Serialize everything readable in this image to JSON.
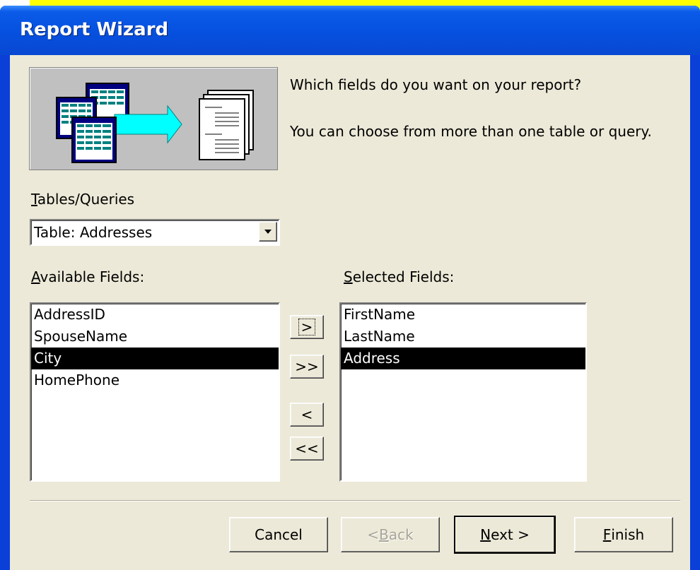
{
  "window": {
    "title": "Report Wizard"
  },
  "prompt": {
    "line1": "Which fields do you want on your report?",
    "line2": "You can choose from more than one table or query."
  },
  "tables_queries": {
    "label_accel": "T",
    "label_rest": "ables/Queries",
    "selected": "Table: Addresses"
  },
  "available_fields": {
    "label_accel": "A",
    "label_rest": "vailable Fields:",
    "items": [
      "AddressID",
      "SpouseName",
      "City",
      "HomePhone"
    ],
    "selected_index": 2
  },
  "selected_fields": {
    "label_accel": "S",
    "label_rest": "elected Fields:",
    "items": [
      "FirstName",
      "LastName",
      "Address"
    ],
    "selected_index": 2
  },
  "move_buttons": {
    "add_one": ">",
    "add_all": ">>",
    "remove_one": "<",
    "remove_all": "<<"
  },
  "footer": {
    "cancel": "Cancel",
    "back_prefix": "< ",
    "back_accel": "B",
    "back_rest": "ack",
    "next_accel": "N",
    "next_rest": "ext >",
    "finish_accel": "F",
    "finish_rest": "inish"
  },
  "colors": {
    "titlebar": "#0650df",
    "dialog_bg": "#ece9d8",
    "selection": "#000000",
    "annotation_yellow": "#ffff00"
  }
}
